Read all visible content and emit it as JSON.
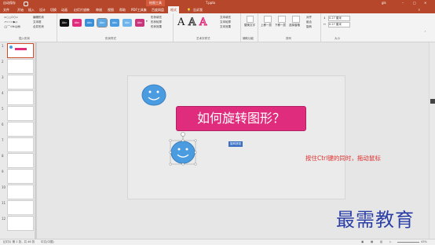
{
  "titlebar": {
    "autosave": "自动保存",
    "toolbar_context": "绘图工具",
    "doc_title": "T.pptx",
    "user": "gls"
  },
  "tabs": [
    "文件",
    "开始",
    "插入",
    "设计",
    "切换",
    "动画",
    "幻灯片放映",
    "审阅",
    "视图",
    "帮助",
    "PDF工具集",
    "百度网盘",
    "格式"
  ],
  "active_tab": "格式",
  "tell_me": "告诉我",
  "ribbon": {
    "insert_shapes": {
      "edit_shape": "编辑形状",
      "text_box": "文本框",
      "merge_shapes": "合并形状",
      "label": "插入形状"
    },
    "shape_styles": {
      "swatches": [
        {
          "text": "Abc",
          "color": "#111111"
        },
        {
          "text": "Abc",
          "color": "#e02c7d"
        },
        {
          "text": "Abc",
          "color": "#3a8fd8"
        },
        {
          "text": "Abc",
          "color": "#5aa9e6"
        },
        {
          "text": "Abc",
          "color": "#4a9be0"
        },
        {
          "text": "Abc",
          "color": "#6fb4ea"
        },
        {
          "text": "Abc",
          "color": "#c8357a"
        }
      ],
      "fill": "形状填充",
      "outline": "形状轮廓",
      "effects": "形状效果",
      "label": "形状样式"
    },
    "wordart": {
      "glyphs": [
        "A",
        "A",
        "A"
      ],
      "text_fill": "文本填充",
      "text_outline": "文本轮廓",
      "text_effects": "文本效果",
      "label": "艺术字样式"
    },
    "accessibility": {
      "alt_text": "替换文字",
      "label": "辅助功能"
    },
    "arrange": {
      "bring_forward": "上移一层",
      "send_backward": "下移一层",
      "selection_pane": "选择窗格",
      "align": "对齐",
      "group": "组合",
      "rotate": "旋转",
      "label": "排列"
    },
    "size": {
      "height": "0.27 厘米",
      "width": "0.27 厘米",
      "label": "大小"
    }
  },
  "thumbnails": [
    "1",
    "2",
    "3",
    "4",
    "5",
    "6",
    "7",
    "8",
    "9",
    "10",
    "11",
    "12"
  ],
  "slide": {
    "title": "如何旋转图形？",
    "note": "按住Ctrl键的同时，拖动鼠标",
    "smart_tag": "旋转按钮"
  },
  "status": {
    "slide_info": "幻灯片 第 1 张，共 46 张",
    "language": "中文(中国)",
    "zoom": "43%"
  },
  "watermark": "最需教育",
  "colors": {
    "accent": "#b7472a",
    "title_box": "#e02c7d",
    "smiley_fill": "#4a9be0",
    "note": "#e03030"
  }
}
